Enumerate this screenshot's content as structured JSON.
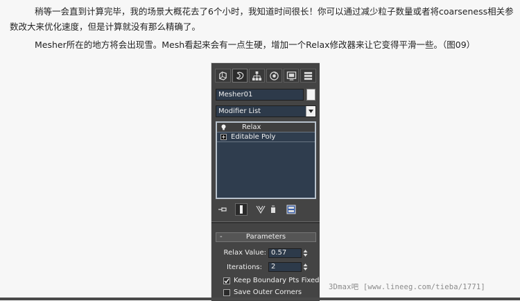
{
  "article": {
    "paragraph1": "稍等一会直到计算完毕，我的场景大概花去了6个小时，我知道时间很长！你可以通过减少粒子数量或者将coarseness相关参数改大来优化速度，但是计算就没有那么精确了。",
    "paragraph2": "Mesher所在的地方将会出现雪。Mesh看起来会有一点生硬，增加一个Relax修改器来让它变得平滑一些。（图09）"
  },
  "panel": {
    "tabs": [
      {
        "icon": "create-icon"
      },
      {
        "icon": "modify-icon"
      },
      {
        "icon": "hierarchy-icon"
      },
      {
        "icon": "motion-icon"
      },
      {
        "icon": "display-icon"
      },
      {
        "icon": "utilities-icon"
      }
    ],
    "object_name": "Mesher01",
    "object_color": "#f4f4f4",
    "modifier_list_label": "Modifier List",
    "stack": [
      {
        "label": "Relax",
        "selected": true,
        "icon": "bulb-icon"
      },
      {
        "label": "Editable Poly",
        "selected": false,
        "icon": "plus-icon"
      }
    ],
    "rollout_title": "Parameters",
    "rollout_toggle": "-",
    "relax_value_label": "Relax Value:",
    "relax_value": "0.57",
    "iterations_label": "Iterations:",
    "iterations": "2",
    "keep_boundary_label": "Keep Boundary Pts Fixed",
    "keep_boundary_checked": true,
    "save_outer_label": "Save Outer Corners",
    "save_outer_checked": false
  },
  "watermark": "3Dmax吧 [www.lineeg.com/tieba/1771]"
}
